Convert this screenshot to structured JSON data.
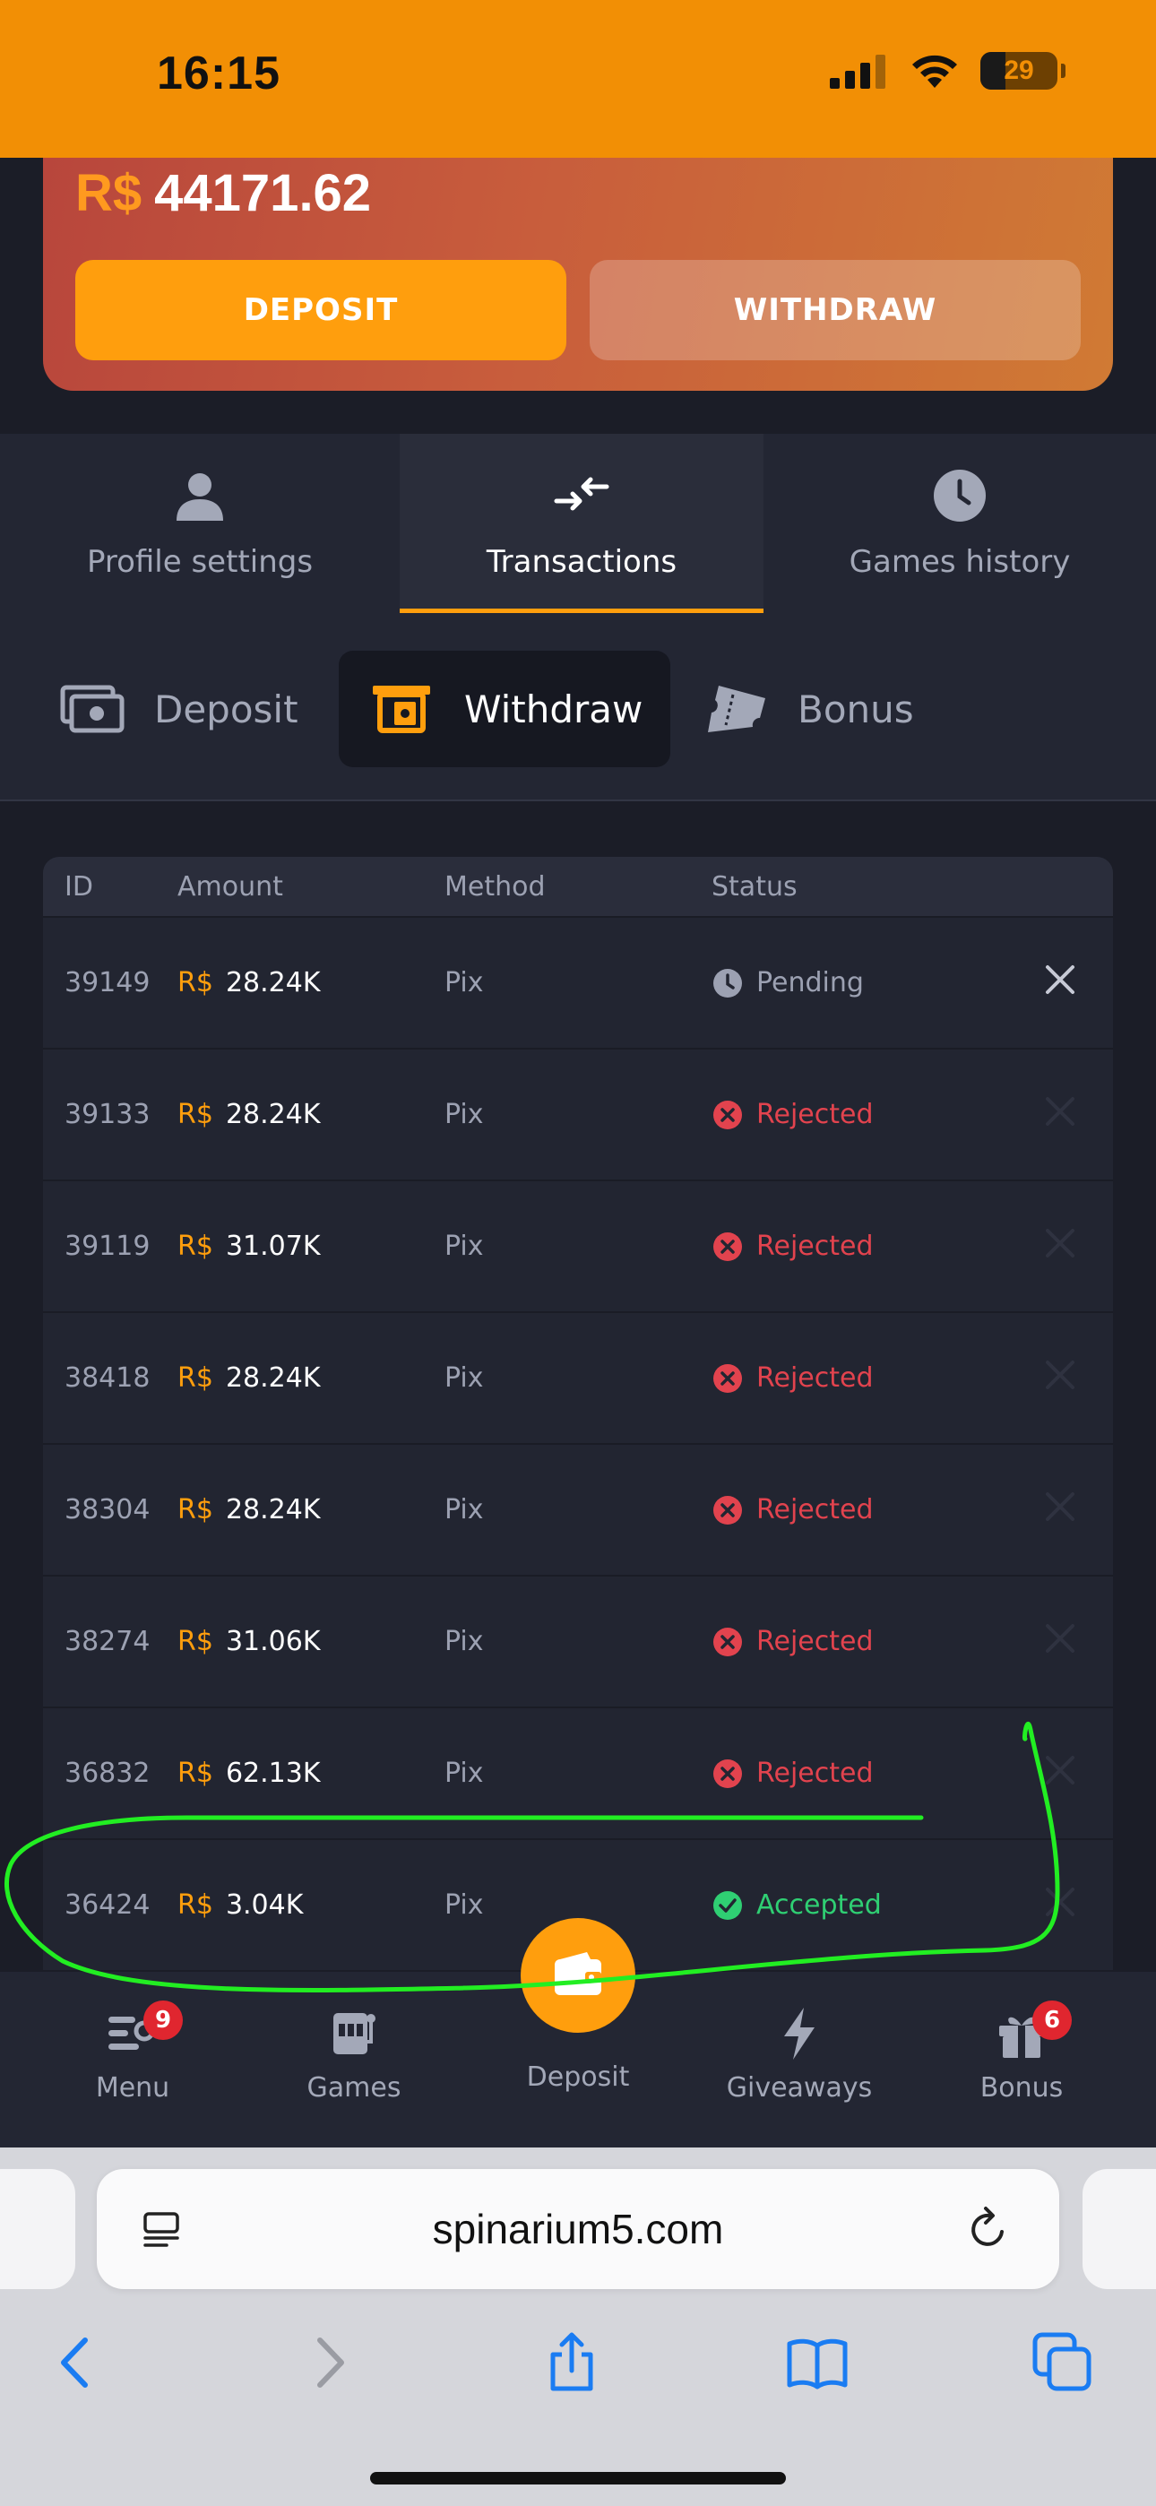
{
  "status_bar": {
    "time": "16:15",
    "battery": "29"
  },
  "balance": {
    "currency": "R$",
    "amount": "44171.62",
    "deposit_label": "DEPOSIT",
    "withdraw_label": "WITHDRAW"
  },
  "main_tabs": [
    {
      "label": "Profile settings",
      "icon": "user-icon"
    },
    {
      "label": "Transactions",
      "icon": "arrows-exchange-icon",
      "active": true
    },
    {
      "label": "Games history",
      "icon": "clock-icon"
    }
  ],
  "sub_tabs": [
    {
      "label": "Deposit",
      "icon": "cash-icon"
    },
    {
      "label": "Withdraw",
      "icon": "withdraw-icon",
      "active": true
    },
    {
      "label": "Bonus",
      "icon": "ticket-icon"
    }
  ],
  "table": {
    "headers": {
      "id": "ID",
      "amount": "Amount",
      "method": "Method",
      "status": "Status"
    },
    "rows": [
      {
        "id": "39149",
        "currency": "R$",
        "amount": "28.24K",
        "method": "Pix",
        "status": "Pending"
      },
      {
        "id": "39133",
        "currency": "R$",
        "amount": "28.24K",
        "method": "Pix",
        "status": "Rejected"
      },
      {
        "id": "39119",
        "currency": "R$",
        "amount": "31.07K",
        "method": "Pix",
        "status": "Rejected"
      },
      {
        "id": "38418",
        "currency": "R$",
        "amount": "28.24K",
        "method": "Pix",
        "status": "Rejected"
      },
      {
        "id": "38304",
        "currency": "R$",
        "amount": "28.24K",
        "method": "Pix",
        "status": "Rejected"
      },
      {
        "id": "38274",
        "currency": "R$",
        "amount": "31.06K",
        "method": "Pix",
        "status": "Rejected"
      },
      {
        "id": "36832",
        "currency": "R$",
        "amount": "62.13K",
        "method": "Pix",
        "status": "Rejected"
      },
      {
        "id": "36424",
        "currency": "R$",
        "amount": "3.04K",
        "method": "Pix",
        "status": "Accepted"
      }
    ]
  },
  "bottom_nav": {
    "menu": {
      "label": "Menu",
      "badge": "9"
    },
    "games": {
      "label": "Games"
    },
    "deposit": {
      "label": "Deposit"
    },
    "giveaways": {
      "label": "Giveaways"
    },
    "bonus": {
      "label": "Bonus",
      "badge": "6"
    }
  },
  "browser": {
    "url": "spinarium5.com"
  },
  "colors": {
    "accent": "#ff9e0d",
    "status_bar": "#f28f05",
    "rejected": "#e2434e",
    "accepted": "#2fcf73",
    "annotation": "#22ee22"
  }
}
